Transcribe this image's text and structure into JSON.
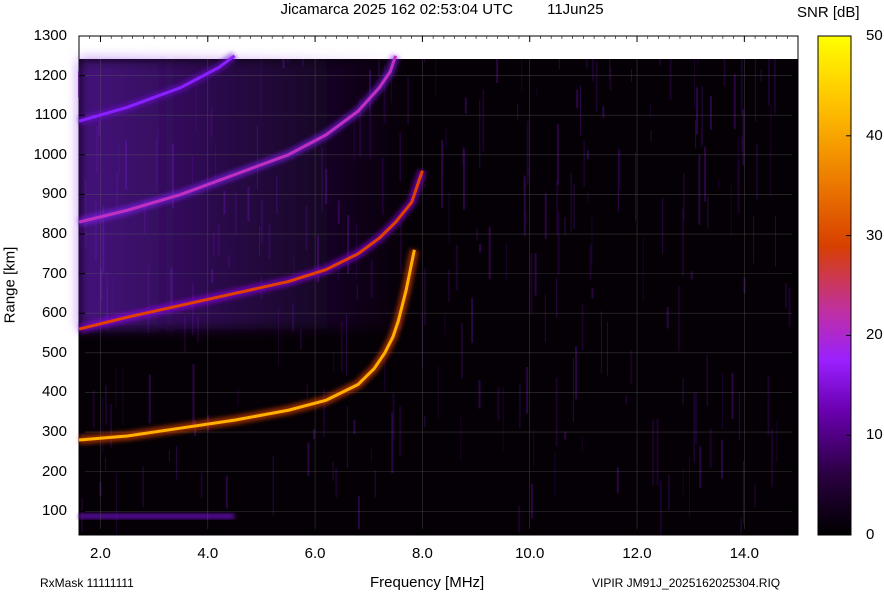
{
  "header": {
    "title": "Jicamarca 2025 162 02:53:04 UTC",
    "date": "11Jun25"
  },
  "footer": {
    "rxmask": "RxMask 11111111",
    "file": "VIPIR  JM91J_2025162025304.RIQ"
  },
  "colorbar": {
    "label": "SNR [dB]",
    "ticks": [
      "50",
      "40",
      "30",
      "20",
      "10",
      "0"
    ],
    "colormap": [
      "#000000",
      "#2a0040",
      "#6a00b0",
      "#9a20ff",
      "#c030a0",
      "#d84000",
      "#ee8000",
      "#ffc000",
      "#ffff00"
    ]
  },
  "chart_data": {
    "type": "heatmap",
    "title": "Jicamarca 2025 162 02:53:04 UTC",
    "xlabel": "Frequency [MHz]",
    "ylabel": "Range [km]",
    "xlim": [
      1.6,
      15.0
    ],
    "ylim": [
      40,
      1300
    ],
    "xticks": [
      "2.0",
      "4.0",
      "6.0",
      "8.0",
      "10.0",
      "12.0",
      "14.0"
    ],
    "yticks": [
      "100",
      "200",
      "300",
      "400",
      "500",
      "600",
      "700",
      "800",
      "900",
      "1000",
      "1100",
      "1200",
      "1300"
    ],
    "zlabel": "SNR [dB]",
    "zlim": [
      0,
      50
    ],
    "grid": true,
    "series": [
      {
        "name": "",
        "x": [
          1.6,
          2.5,
          3.5,
          4.5,
          5.5,
          6.2,
          6.8,
          7.1,
          7.3,
          7.45,
          7.55,
          7.7,
          7.85
        ],
        "y": [
          280,
          290,
          310,
          330,
          355,
          380,
          420,
          460,
          500,
          540,
          580,
          660,
          760
        ]
      },
      {
        "name": "",
        "x": [
          1.6,
          2.5,
          3.5,
          4.5,
          5.5,
          6.2,
          6.8,
          7.2,
          7.5,
          7.8,
          8.0
        ],
        "y": [
          560,
          590,
          620,
          650,
          680,
          710,
          750,
          790,
          830,
          880,
          960
        ]
      },
      {
        "name": "",
        "x": [
          1.6,
          2.5,
          3.5,
          4.5,
          5.5,
          6.2,
          6.8,
          7.2,
          7.4,
          7.5
        ],
        "y": [
          830,
          860,
          900,
          950,
          1000,
          1050,
          1110,
          1170,
          1210,
          1250
        ]
      },
      {
        "name": "",
        "x": [
          1.6,
          2.5,
          3.5,
          4.2,
          4.5
        ],
        "y": [
          1085,
          1120,
          1170,
          1220,
          1250
        ]
      }
    ]
  }
}
